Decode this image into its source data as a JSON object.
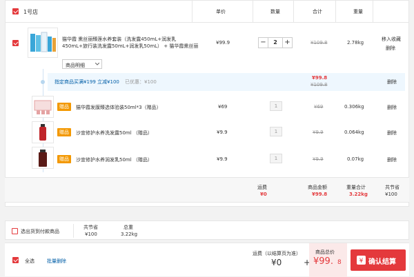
{
  "header": {
    "store_name": "1号店",
    "col_price": "单价",
    "col_qty": "数量",
    "col_total": "合计",
    "col_weight": "重量"
  },
  "main_item": {
    "title": "猫华霞 熏丝丽臻莲水养套装（洗发露450mL+润发乳450mL+旅行装洗发露50mL+润发乳50mL） + 猫华霞熏丝丽",
    "price": "¥99.9",
    "qty": "2",
    "orig_total": "¥109.8",
    "weight": "2.78kg",
    "action_favorite": "移入收藏",
    "action_delete": "删除",
    "detail_select": "商品明细"
  },
  "promo": {
    "label": "指定商品买满¥199 立减¥100",
    "saved": "已优惠：¥100",
    "total": "¥99.8",
    "orig": "¥109.8",
    "delete": "删除"
  },
  "gifts": [
    {
      "tag": "赠品",
      "name": "猫华霞发膜臻选体验装50ml*3（赠品）",
      "price": "¥69",
      "qty": "1",
      "orig": "¥69",
      "weight": "0.306kg",
      "delete": "删除"
    },
    {
      "tag": "赠品",
      "name": "沙宣修护水养洗发露50ml （赠品）",
      "price": "¥9.9",
      "qty": "1",
      "orig": "¥9.9",
      "weight": "0.064kg",
      "delete": "删除"
    },
    {
      "tag": "赠品",
      "name": "沙宣修护水养润发乳50ml （赠品）",
      "price": "¥9.9",
      "qty": "1",
      "orig": "¥9.9",
      "weight": "0.07kg",
      "delete": "删除"
    }
  ],
  "store_summary": {
    "shipping_label": "运费",
    "shipping_value": "¥0",
    "amount_label": "商品金额",
    "amount_value": "¥99.8",
    "weight_label": "重量合计",
    "weight_value": "3.22kg",
    "saved_label": "共节省",
    "saved_value": "¥100"
  },
  "cod_bar": {
    "label": "选出货到付款商品",
    "saved_label": "共节省",
    "saved_value": "¥100",
    "weight_label": "总重",
    "weight_value": "3.22kg"
  },
  "footer": {
    "select_all": "全选",
    "batch_delete": "批量删除",
    "shipping_label": "运费（以结算页为准）",
    "shipping_value": "¥0",
    "plus": "+",
    "total_label": "商品总价",
    "total_value": "¥99.",
    "total_value_small": "8",
    "checkout": "确认结算"
  },
  "colors": {
    "accent": "#e4393c",
    "gift_tag": "#f39800",
    "promo_bg": "#eef7fe",
    "link": "#005ea7"
  }
}
